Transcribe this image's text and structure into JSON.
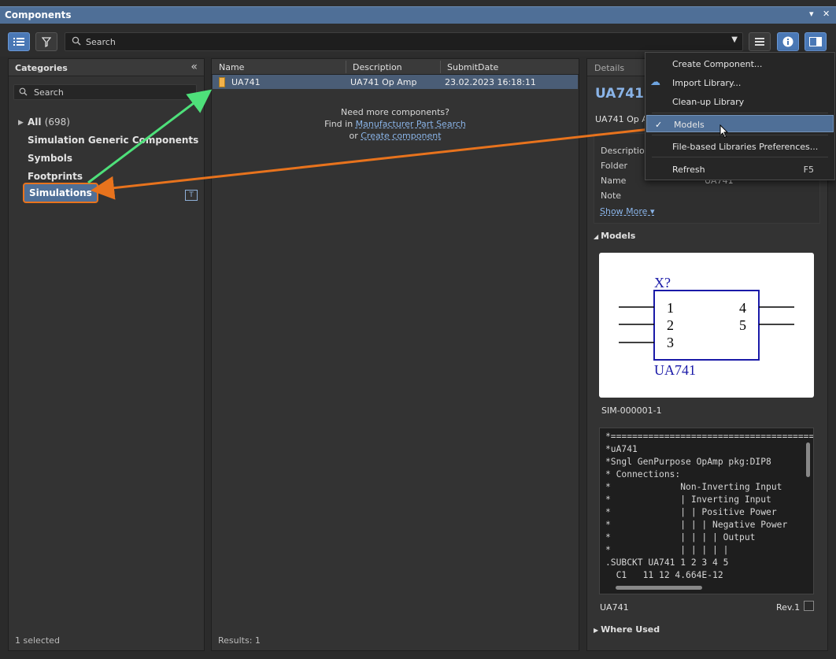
{
  "window": {
    "title": "Components",
    "pin_icon": "▾",
    "close_icon": "✕"
  },
  "toolbar": {
    "search_placeholder": "Search"
  },
  "categories": {
    "title": "Categories",
    "search_placeholder": "Search",
    "all_label": "All",
    "all_count": "(698)",
    "items": [
      "Simulation Generic Components",
      "Symbols",
      "Footprints",
      "Simulations"
    ],
    "footer": "1 selected"
  },
  "list": {
    "columns": [
      "Name",
      "Description",
      "SubmitDate"
    ],
    "rows": [
      {
        "name": "UA741",
        "description": "UA741 Op Amp",
        "submit_date": "23.02.2023 16:18:11"
      }
    ],
    "need_more": "Need more components?",
    "find_in": "Find in",
    "mps_link": "Manufacturer Part Search",
    "or": "or",
    "create_link": "Create component",
    "footer": "Results: 1"
  },
  "details": {
    "title": "Details",
    "name": "UA741",
    "description_short": "UA741 Op A",
    "props": [
      {
        "key": "Description",
        "value": ""
      },
      {
        "key": "Folder",
        "value": ""
      },
      {
        "key": "Name",
        "value": "UA741"
      },
      {
        "key": "Note",
        "value": ""
      }
    ],
    "show_more": "Show More ▾",
    "models_heading": "Models",
    "symbol": {
      "designator": "X?",
      "pins_left": [
        "1",
        "2",
        "3"
      ],
      "pins_right": [
        "4",
        "5"
      ],
      "comment": "UA741"
    },
    "sim_id": "SIM-000001-1",
    "spice_lines": [
      "*=============================================",
      "*uA741",
      "*Sngl GenPurpose OpAmp pkg:DIP8",
      "* Connections:",
      "*             Non-Inverting Input",
      "*             | Inverting Input",
      "*             | | Positive Power",
      "*             | | | Negative Power",
      "*             | | | | Output",
      "*             | | | | |",
      ".SUBCKT UA741 1 2 3 4 5",
      "  C1   11 12 4.664E-12"
    ],
    "part_name": "UA741",
    "rev": "Rev.1",
    "where_used": "Where Used"
  },
  "menu": {
    "items": [
      {
        "label": "Create Component...",
        "shortcut": ""
      },
      {
        "label": "Import Library...",
        "shortcut": ""
      },
      {
        "label": "Clean-up Library",
        "shortcut": ""
      },
      {
        "label": "Models",
        "shortcut": "",
        "checked": true
      },
      {
        "label": "File-based Libraries Preferences...",
        "shortcut": ""
      },
      {
        "label": "Refresh",
        "shortcut": "F5"
      }
    ]
  },
  "colors": {
    "accent": "#4f6f97",
    "annotation_orange": "#e8731d",
    "annotation_green": "#4ee07a",
    "link": "#8ab4e8"
  }
}
